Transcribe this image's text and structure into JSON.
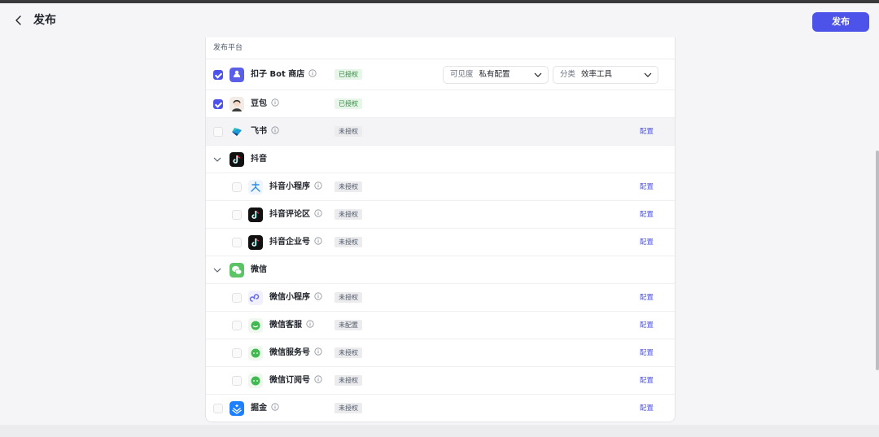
{
  "header": {
    "title": "发布",
    "publish_label": "发布"
  },
  "panel": {
    "section_label": "发布平台"
  },
  "rows": {
    "koze": {
      "name": "扣子 Bot 商店",
      "status": "已授权",
      "visibility": {
        "label": "可见度",
        "value": "私有配置"
      },
      "category": {
        "label": "分类",
        "value": "效率工具"
      }
    },
    "doubao": {
      "name": "豆包",
      "status": "已授权"
    },
    "feishu": {
      "name": "飞书",
      "status": "未授权",
      "action": "配置"
    },
    "douyin_group": {
      "name": "抖音"
    },
    "douyin_mini": {
      "name": "抖音小程序",
      "status": "未授权",
      "action": "配置"
    },
    "douyin_comment": {
      "name": "抖音评论区",
      "status": "未授权",
      "action": "配置"
    },
    "douyin_enterprise": {
      "name": "抖音企业号",
      "status": "未授权",
      "action": "配置"
    },
    "wechat_group": {
      "name": "微信"
    },
    "wechat_mini": {
      "name": "微信小程序",
      "status": "未授权",
      "action": "配置"
    },
    "wechat_service_chat": {
      "name": "微信客服",
      "status": "未配置",
      "action": "配置"
    },
    "wechat_service_account": {
      "name": "微信服务号",
      "status": "未授权",
      "action": "配置"
    },
    "wechat_subscription": {
      "name": "微信订阅号",
      "status": "未授权",
      "action": "配置"
    },
    "juejin": {
      "name": "掘金",
      "status": "未授权",
      "action": "配置"
    }
  },
  "colors": {
    "accent": "#4d53e8",
    "authorized_bg": "#e8f6ea",
    "authorized_text": "#2e8b3e"
  }
}
